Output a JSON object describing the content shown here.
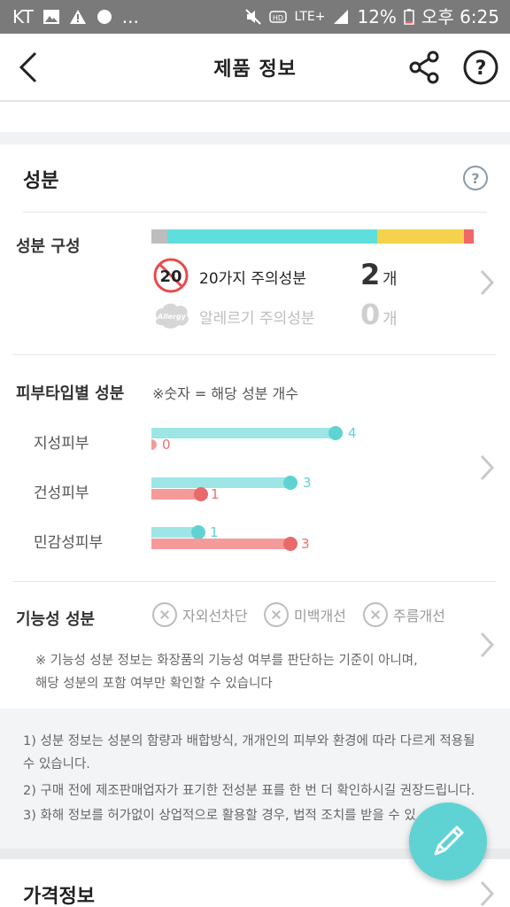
{
  "status": {
    "carrier": "KT",
    "dots": "...",
    "network": "LTE+",
    "battery": "12%",
    "time": "오후 6:25"
  },
  "header": {
    "title": "제품 정보"
  },
  "ingredients": {
    "title": "성분",
    "composition_label": "성분 구성",
    "composition_bar": [
      {
        "color": "#bdbdbd",
        "fraction": 0.05
      },
      {
        "color": "#5fdede",
        "fraction": 0.65
      },
      {
        "color": "#f4d24b",
        "fraction": 0.27
      },
      {
        "color": "#f06767",
        "fraction": 0.03
      }
    ],
    "caution20_label": "20가지 주의성분",
    "caution20_badge": "20",
    "caution20_count": "2",
    "caution20_unit": "개",
    "allergy_label": "알레르기 주의성분",
    "allergy_badge": "Allergy",
    "allergy_count": "0",
    "allergy_unit": "개"
  },
  "skin": {
    "title": "피부타입별 성분",
    "hint": "※숫자 = 해당 성분 개수",
    "rows": [
      {
        "label": "지성피부",
        "good": "4",
        "bad": "0"
      },
      {
        "label": "건성피부",
        "good": "3",
        "bad": "1"
      },
      {
        "label": "민감성피부",
        "good": "1",
        "bad": "3"
      }
    ]
  },
  "functional": {
    "title": "기능성 성분",
    "tags": [
      "자외선차단",
      "미백개선",
      "주름개선"
    ],
    "note_line1": "※ 기능성 성분 정보는 화장품의 기능성 여부를 판단하는 기준이 아니며,",
    "note_line2": "해당 성분의 포함 여부만 확인할 수 있습니다"
  },
  "footer_notes": {
    "line1": "1) 성분 정보는 성분의 함량과 배합방식, 개개인의 피부와 환경에 따라 다르게 적용될",
    "line1b": "수 있습니다.",
    "line2": "2) 구매 전에 제조판매업자가 표기한 전성분 표를 한 번 더 확인하시길 권장드립니다.",
    "line3": "3) 화해 정보를 허가없이 상업적으로 활용할 경우, 법적 조치를 받을 수 있"
  },
  "price": {
    "title": "가격정보"
  },
  "colors": {
    "teal": "#5fd3d4",
    "pink": "#f59a9a",
    "red": "#e84b4b"
  }
}
